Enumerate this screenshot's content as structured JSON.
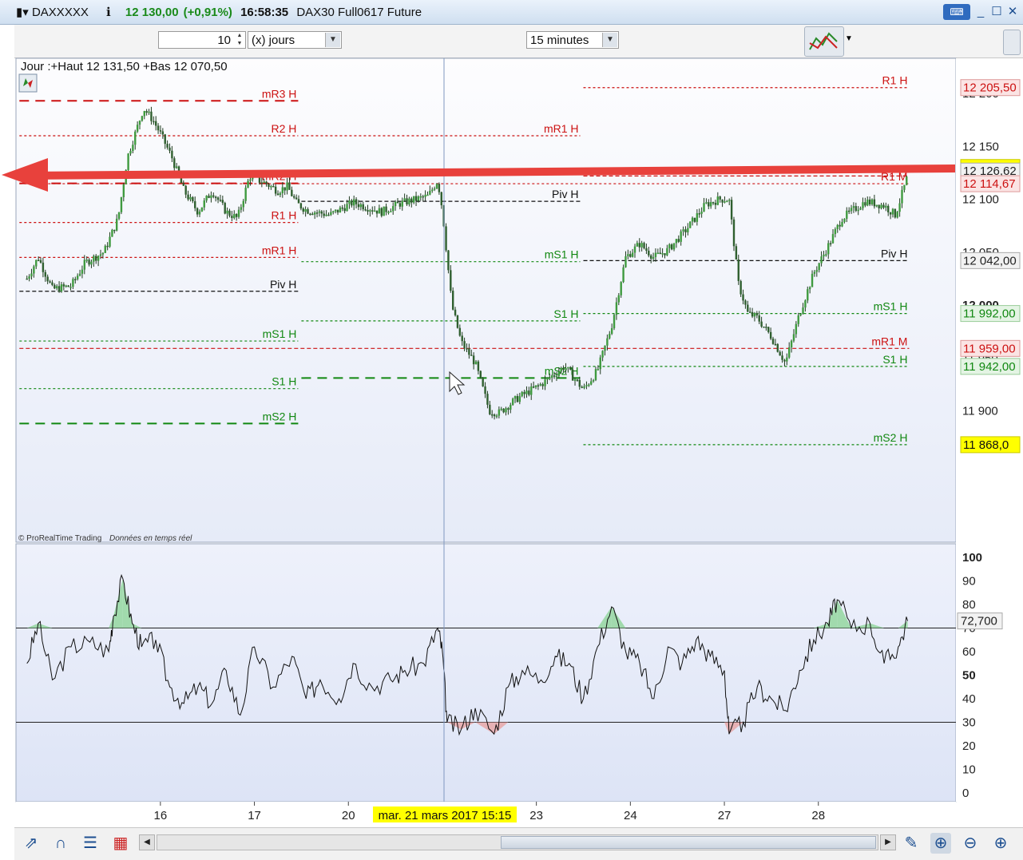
{
  "window": {
    "symbol": "DAXXXXX",
    "price": "12 130,00",
    "change": "(+0,91%)",
    "time": "16:58:35",
    "instrument": "DAX30 Full0617 Future",
    "controls": [
      "_",
      "☐",
      "✕"
    ]
  },
  "toolbar": {
    "period_value": "10",
    "period_unit": "(x) jours",
    "timeframe": "15 minutes"
  },
  "chart_data": {
    "type": "candlestick",
    "header": "Jour :+Haut 12 131,50 +Bas 12 070,50",
    "copyright": "© ProRealTime Trading",
    "realtime_note": "Données en temps réel",
    "x_ticks": [
      "16",
      "17",
      "20",
      "23",
      "24",
      "27",
      "28"
    ],
    "x_tick_pos": [
      0.5,
      1.5,
      2.5,
      4.5,
      5.5,
      6.5,
      7.5
    ],
    "crosshair_label": "mar. 21 mars 2017 15:15",
    "price_axis": {
      "ylim": [
        11860,
        12215
      ],
      "ticks": [
        {
          "v": 12200,
          "label": "12 200"
        },
        {
          "v": 12150,
          "label": "12 150"
        },
        {
          "v": 12100,
          "label": "12 100"
        },
        {
          "v": 12050,
          "label": "12 050"
        },
        {
          "v": 12000,
          "label": "12 000"
        },
        {
          "v": 11950,
          "label": "11 950"
        },
        {
          "v": 11900,
          "label": "11 900"
        }
      ]
    },
    "price_tags": [
      {
        "v": 12205.5,
        "label": "12 205,50",
        "style": "red"
      },
      {
        "v": 12130.0,
        "label": "12 130,00",
        "style": "yellow"
      },
      {
        "v": 12126.62,
        "label": "12 126,62",
        "style": "grey"
      },
      {
        "v": 12114.67,
        "label": "12 114,67",
        "style": "red"
      },
      {
        "v": 12042.0,
        "label": "12 042,00",
        "style": "grey"
      },
      {
        "v": 11992.0,
        "label": "11 992,00",
        "style": "green"
      },
      {
        "v": 11959.0,
        "label": "11 959,00",
        "style": "red"
      },
      {
        "v": 11942.0,
        "label": "11 942,00",
        "style": "green"
      },
      {
        "v": 11868.0,
        "label": "11 868,0",
        "style": "yellow"
      }
    ],
    "levels": [
      {
        "label": "mR3 H",
        "v": 12193,
        "d0": -1.0,
        "d1": 2.0,
        "color": "#cc1111",
        "style": "long"
      },
      {
        "label": "R2 H",
        "v": 12160,
        "d0": -1.0,
        "d1": 2.0,
        "color": "#cc1111",
        "style": "dot"
      },
      {
        "label": "mR2 H",
        "v": 12115,
        "d0": -1.0,
        "d1": 2.0,
        "color": "#cc1111",
        "style": "long"
      },
      {
        "label": "R1 H",
        "v": 12078,
        "d0": -1.0,
        "d1": 2.0,
        "color": "#cc1111",
        "style": "dot"
      },
      {
        "label": "mR1 H",
        "v": 12045,
        "d0": -1.0,
        "d1": 2.0,
        "color": "#cc1111",
        "style": "dot"
      },
      {
        "label": "Piv H",
        "v": 12013,
        "d0": -1.0,
        "d1": 2.0,
        "color": "#111111",
        "style": "dash"
      },
      {
        "label": "mS1 H",
        "v": 11966,
        "d0": -1.0,
        "d1": 2.0,
        "color": "#118811",
        "style": "dot"
      },
      {
        "label": "S1 H",
        "v": 11921,
        "d0": -1.0,
        "d1": 2.0,
        "color": "#118811",
        "style": "dot"
      },
      {
        "label": "mS2 H",
        "v": 11888,
        "d0": -1.0,
        "d1": 2.0,
        "color": "#118811",
        "style": "long"
      },
      {
        "label": "mR1 H",
        "v": 12160,
        "d0": 2.0,
        "d1": 5.0,
        "color": "#cc1111",
        "style": "dot"
      },
      {
        "label": "Piv H",
        "v": 12098,
        "d0": 2.0,
        "d1": 5.0,
        "color": "#111111",
        "style": "dash"
      },
      {
        "label": "mS1 H",
        "v": 12041,
        "d0": 2.0,
        "d1": 5.0,
        "color": "#118811",
        "style": "dot"
      },
      {
        "label": "S1 H",
        "v": 11985,
        "d0": 2.0,
        "d1": 5.0,
        "color": "#118811",
        "style": "dot"
      },
      {
        "label": "mS2 H",
        "v": 11931,
        "d0": 2.0,
        "d1": 5.0,
        "color": "#118811",
        "style": "long"
      },
      {
        "label": "R1 H",
        "v": 12205.5,
        "d0": 5.0,
        "d1": 8.5,
        "color": "#cc1111",
        "style": "dot"
      },
      {
        "label": "mR1 H",
        "v": 12122,
        "d0": 5.0,
        "d1": 8.5,
        "color": "#cc1111",
        "style": "dash"
      },
      {
        "label": "R1 M",
        "v": 12114.67,
        "d0": -1.0,
        "d1": 8.5,
        "color": "#cc1111",
        "style": "dot"
      },
      {
        "label": "Piv H",
        "v": 12042,
        "d0": 5.0,
        "d1": 8.5,
        "color": "#111111",
        "style": "dash"
      },
      {
        "label": "mS1 H",
        "v": 11992,
        "d0": 5.0,
        "d1": 8.5,
        "color": "#118811",
        "style": "dot"
      },
      {
        "label": "mR1 M",
        "v": 11959,
        "d0": -1.0,
        "d1": 8.5,
        "color": "#cc1111",
        "style": "dash"
      },
      {
        "label": "S1 H",
        "v": 11942,
        "d0": 5.0,
        "d1": 8.5,
        "color": "#118811",
        "style": "dot"
      },
      {
        "label": "mS2 H",
        "v": 11868,
        "d0": 5.0,
        "d1": 8.5,
        "color": "#118811",
        "style": "dot"
      }
    ],
    "price_path": [
      [
        -0.92,
        12025
      ],
      [
        -0.8,
        12045
      ],
      [
        -0.65,
        12015
      ],
      [
        -0.45,
        12018
      ],
      [
        -0.3,
        12040
      ],
      [
        -0.1,
        12050
      ],
      [
        0.05,
        12082
      ],
      [
        0.15,
        12140
      ],
      [
        0.32,
        12186
      ],
      [
        0.42,
        12175
      ],
      [
        0.5,
        12162
      ],
      [
        0.62,
        12140
      ],
      [
        0.75,
        12108
      ],
      [
        0.9,
        12088
      ],
      [
        1.05,
        12108
      ],
      [
        1.2,
        12088
      ],
      [
        1.32,
        12082
      ],
      [
        1.45,
        12122
      ],
      [
        1.62,
        12115
      ],
      [
        1.75,
        12108
      ],
      [
        1.85,
        12112
      ],
      [
        1.95,
        12096
      ],
      [
        2.05,
        12090
      ],
      [
        2.3,
        12085
      ],
      [
        2.55,
        12097
      ],
      [
        2.85,
        12088
      ],
      [
        3.05,
        12096
      ],
      [
        3.35,
        12103
      ],
      [
        3.45,
        12118
      ],
      [
        3.5,
        12090
      ],
      [
        3.6,
        12000
      ],
      [
        3.7,
        11965
      ],
      [
        3.85,
        11945
      ],
      [
        4.0,
        11900
      ],
      [
        4.1,
        11898
      ],
      [
        4.3,
        11912
      ],
      [
        4.55,
        11925
      ],
      [
        4.8,
        11942
      ],
      [
        5.0,
        11920
      ],
      [
        5.15,
        11938
      ],
      [
        5.3,
        11980
      ],
      [
        5.45,
        12045
      ],
      [
        5.6,
        12058
      ],
      [
        5.75,
        12045
      ],
      [
        5.9,
        12052
      ],
      [
        6.1,
        12072
      ],
      [
        6.3,
        12095
      ],
      [
        6.45,
        12100
      ],
      [
        6.55,
        12100
      ],
      [
        6.65,
        12020
      ],
      [
        6.75,
        11992
      ],
      [
        6.85,
        11988
      ],
      [
        7.0,
        11970
      ],
      [
        7.15,
        11945
      ],
      [
        7.3,
        11992
      ],
      [
        7.45,
        12030
      ],
      [
        7.6,
        12055
      ],
      [
        7.75,
        12082
      ],
      [
        8.0,
        12098
      ],
      [
        8.2,
        12094
      ],
      [
        8.32,
        12085
      ],
      [
        8.45,
        12122
      ]
    ],
    "rsi": {
      "ylim": [
        -5,
        105
      ],
      "ticks": [
        100,
        90,
        80,
        70,
        60,
        50,
        40,
        30,
        20,
        10,
        0
      ],
      "overbought": 70,
      "oversold": 30,
      "last_label": "72,700",
      "path": [
        [
          -0.92,
          55
        ],
        [
          -0.8,
          72
        ],
        [
          -0.65,
          48
        ],
        [
          -0.45,
          62
        ],
        [
          -0.25,
          64
        ],
        [
          -0.05,
          60
        ],
        [
          0.0,
          75
        ],
        [
          0.1,
          91
        ],
        [
          0.2,
          72
        ],
        [
          0.3,
          62
        ],
        [
          0.45,
          65
        ],
        [
          0.6,
          45
        ],
        [
          0.75,
          38
        ],
        [
          0.9,
          45
        ],
        [
          1.05,
          38
        ],
        [
          1.2,
          52
        ],
        [
          1.35,
          33
        ],
        [
          1.5,
          62
        ],
        [
          1.7,
          45
        ],
        [
          1.9,
          58
        ],
        [
          2.05,
          40
        ],
        [
          2.2,
          48
        ],
        [
          2.4,
          40
        ],
        [
          2.55,
          55
        ],
        [
          2.75,
          45
        ],
        [
          2.95,
          48
        ],
        [
          3.1,
          52
        ],
        [
          3.3,
          55
        ],
        [
          3.45,
          70
        ],
        [
          3.5,
          60
        ],
        [
          3.55,
          30
        ],
        [
          3.7,
          27
        ],
        [
          3.85,
          36
        ],
        [
          4.05,
          25
        ],
        [
          4.2,
          45
        ],
        [
          4.35,
          52
        ],
        [
          4.55,
          48
        ],
        [
          4.7,
          58
        ],
        [
          4.85,
          55
        ],
        [
          5.0,
          40
        ],
        [
          5.15,
          62
        ],
        [
          5.3,
          79
        ],
        [
          5.45,
          60
        ],
        [
          5.6,
          55
        ],
        [
          5.75,
          40
        ],
        [
          5.9,
          62
        ],
        [
          6.05,
          55
        ],
        [
          6.2,
          65
        ],
        [
          6.35,
          58
        ],
        [
          6.5,
          52
        ],
        [
          6.55,
          25
        ],
        [
          6.7,
          30
        ],
        [
          6.85,
          45
        ],
        [
          7.0,
          40
        ],
        [
          7.15,
          35
        ],
        [
          7.3,
          52
        ],
        [
          7.45,
          65
        ],
        [
          7.6,
          72
        ],
        [
          7.7,
          82
        ],
        [
          7.85,
          70
        ],
        [
          8.05,
          72
        ],
        [
          8.2,
          55
        ],
        [
          8.35,
          62
        ],
        [
          8.45,
          73
        ]
      ]
    },
    "annotation": "red arrow pointing left at ~12 130 level"
  }
}
